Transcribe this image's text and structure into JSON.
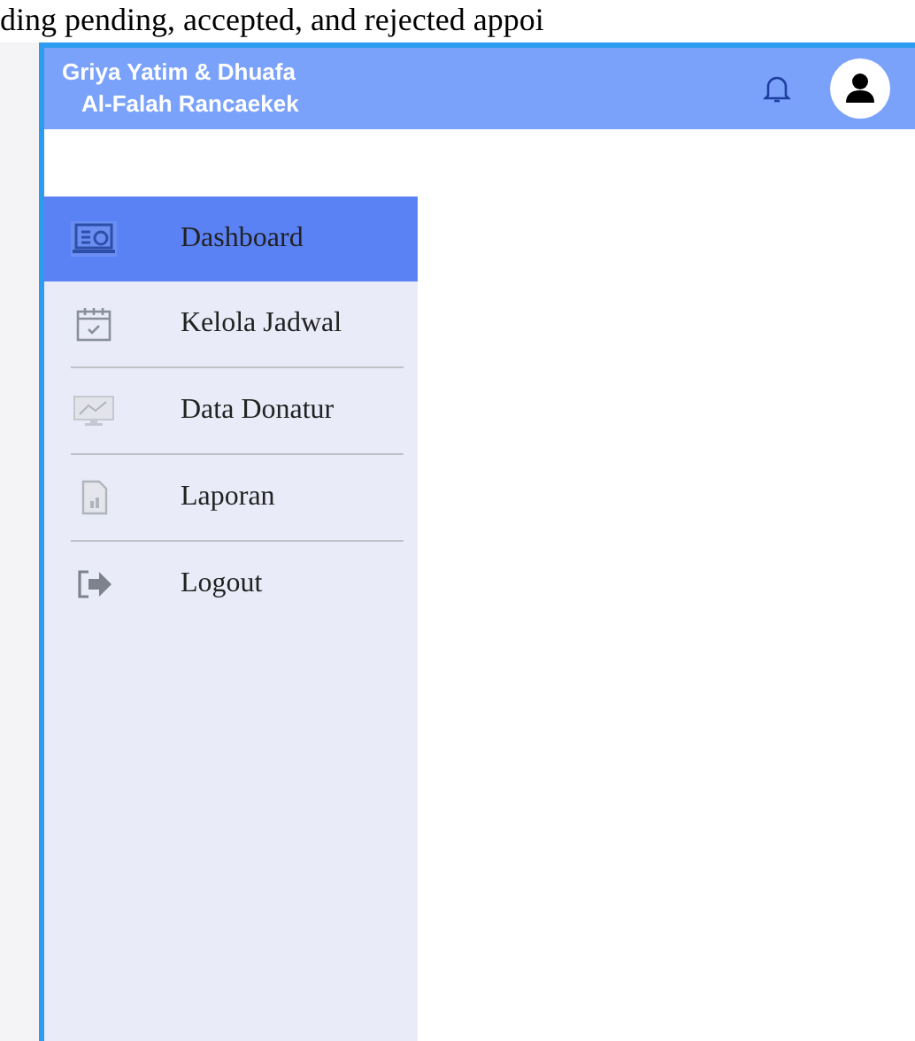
{
  "caption": "ding pending, accepted, and rejected appoi",
  "header": {
    "title_line_1": "Griya Yatim & Dhuafa",
    "title_line_2": "Al-Falah Rancaekek"
  },
  "sidebar": {
    "items": [
      {
        "label": "Dashboard",
        "selected": true
      },
      {
        "label": "Kelola Jadwal",
        "selected": false
      },
      {
        "label": "Data Donatur",
        "selected": false
      },
      {
        "label": "Laporan",
        "selected": false
      },
      {
        "label": "Logout",
        "selected": false
      }
    ]
  }
}
